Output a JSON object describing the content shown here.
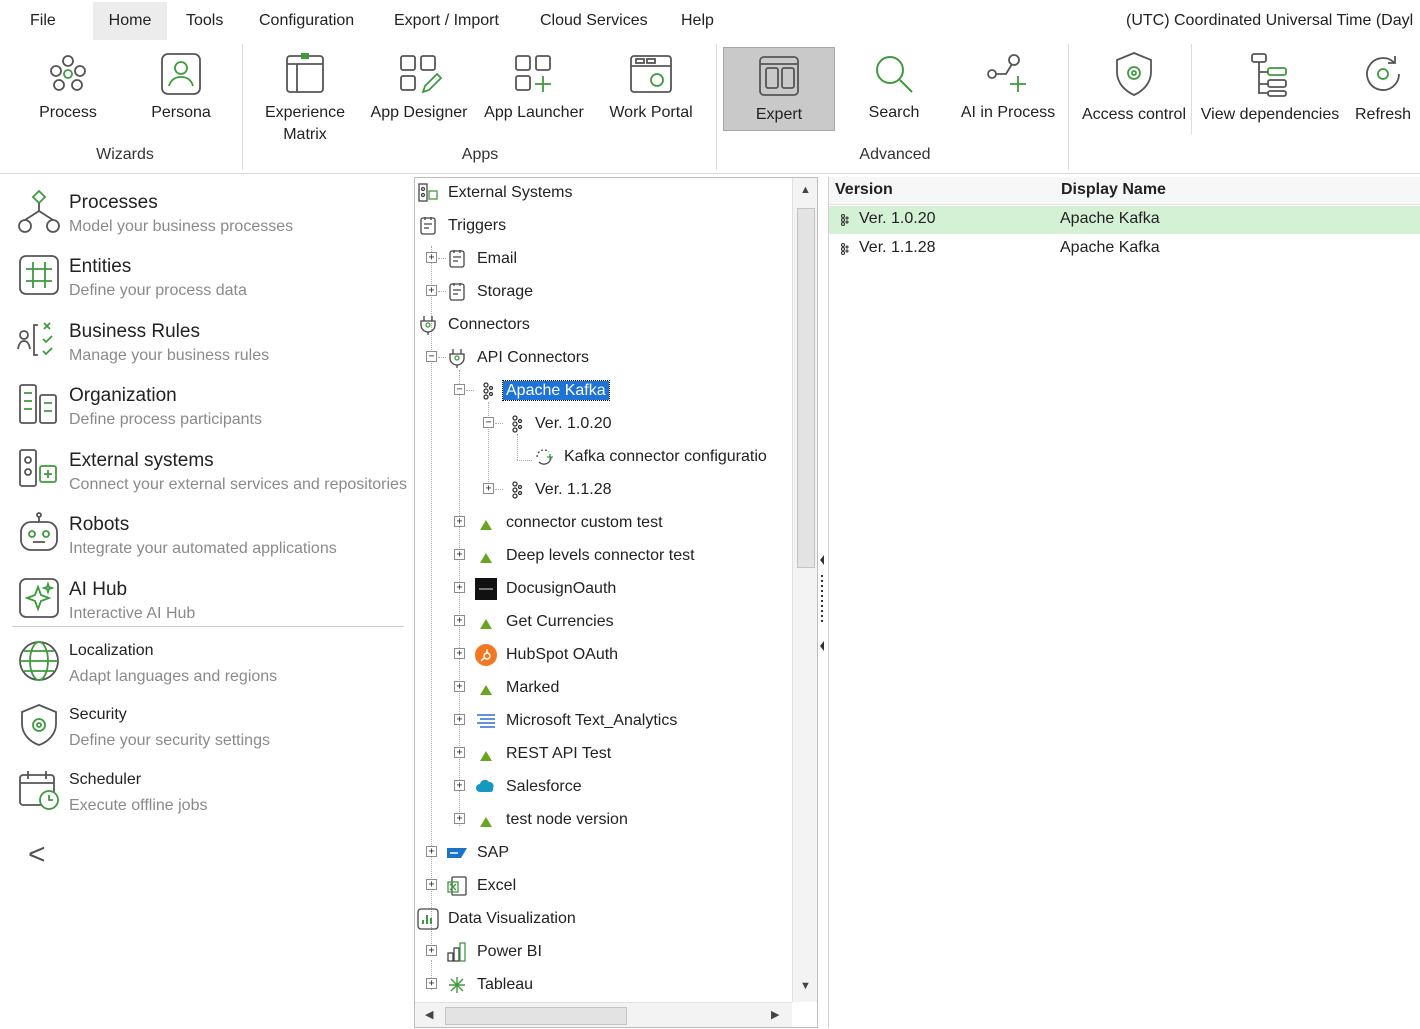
{
  "menu": {
    "items": [
      "File",
      "Home",
      "Tools",
      "Configuration",
      "Export / Import",
      "Cloud Services",
      "Help"
    ],
    "active": "Home",
    "timezone": "(UTC) Coordinated Universal Time (Dayl"
  },
  "ribbon": {
    "buttons": {
      "process": "Process",
      "persona": "Persona",
      "experience_matrix_line1": "Experience",
      "experience_matrix_line2": "Matrix",
      "app_designer": "App Designer",
      "app_launcher": "App Launcher",
      "work_portal": "Work Portal",
      "expert": "Expert",
      "search": "Search",
      "ai_in_process": "AI in Process",
      "access_control": "Access control",
      "view_dependencies": "View dependencies",
      "refresh": "Refresh"
    },
    "groups": {
      "wizards": "Wizards",
      "apps": "Apps",
      "advanced": "Advanced"
    }
  },
  "leftnav": {
    "items": [
      {
        "title": "Processes",
        "subtitle": "Model your business processes"
      },
      {
        "title": "Entities",
        "subtitle": "Define your process data"
      },
      {
        "title": "Business Rules",
        "subtitle": "Manage your business rules"
      },
      {
        "title": "Organization",
        "subtitle": "Define process participants"
      },
      {
        "title": "External systems",
        "subtitle": "Connect your external services and repositories"
      },
      {
        "title": "Robots",
        "subtitle": "Integrate your automated applications"
      },
      {
        "title": "AI Hub",
        "subtitle": "Interactive AI Hub"
      },
      {
        "title": "Localization",
        "subtitle": "Adapt languages and regions"
      },
      {
        "title": "Security",
        "subtitle": "Define your security settings"
      },
      {
        "title": "Scheduler",
        "subtitle": "Execute offline jobs"
      }
    ],
    "collapse_glyph": "<"
  },
  "tree": {
    "nodes": [
      {
        "label": "External Systems"
      },
      {
        "label": "Triggers"
      },
      {
        "label": "Email"
      },
      {
        "label": "Storage"
      },
      {
        "label": "Connectors"
      },
      {
        "label": "API Connectors"
      },
      {
        "label": "Apache Kafka"
      },
      {
        "label": "Ver. 1.0.20"
      },
      {
        "label": "Kafka connector configuratio"
      },
      {
        "label": "Ver. 1.1.28"
      },
      {
        "label": "connector custom test"
      },
      {
        "label": "Deep levels connector test"
      },
      {
        "label": "DocusignOauth"
      },
      {
        "label": "Get Currencies"
      },
      {
        "label": "HubSpot OAuth"
      },
      {
        "label": "Marked"
      },
      {
        "label": "Microsoft Text_Analytics"
      },
      {
        "label": "REST API Test"
      },
      {
        "label": "Salesforce"
      },
      {
        "label": "test node version"
      },
      {
        "label": "SAP"
      },
      {
        "label": "Excel"
      },
      {
        "label": "Data Visualization"
      },
      {
        "label": "Power BI"
      },
      {
        "label": "Tableau"
      }
    ]
  },
  "grid": {
    "columns": [
      "Version",
      "Display Name"
    ],
    "rows": [
      {
        "version": "Ver. 1.0.20",
        "display_name": "Apache Kafka"
      },
      {
        "version": "Ver. 1.1.28",
        "display_name": "Apache Kafka"
      }
    ]
  },
  "colors": {
    "selection_blue": "#1e73d6",
    "row_selected_green": "#d5f1d5",
    "icon_green": "#3f9a3f",
    "hubspot_orange": "#f57722",
    "salesforce_blue": "#1798c1"
  }
}
